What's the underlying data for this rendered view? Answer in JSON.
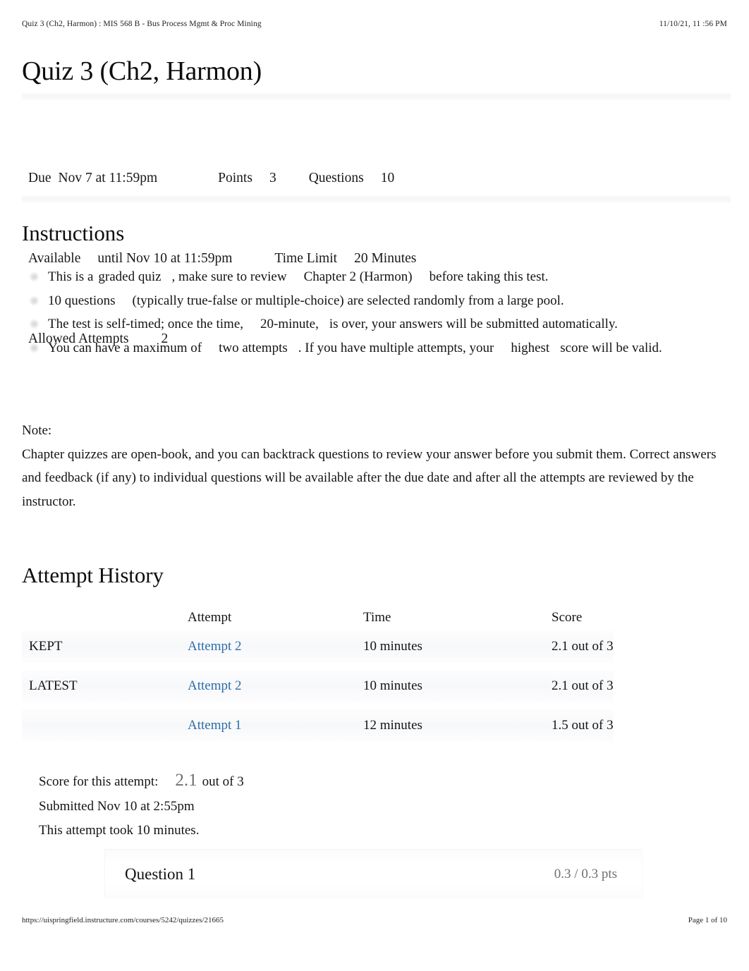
{
  "print_header": {
    "document_title": "Quiz 3 (Ch2, Harmon) : MIS 568 B - Bus Process Mgmt & Proc Mining",
    "timestamp": "11/10/21, 11 :56 PM"
  },
  "print_footer": {
    "url": "https://uispringfield.instructure.com/courses/5242/quizzes/21665",
    "page_label": "Page 1 of 10"
  },
  "quiz": {
    "title": "Quiz 3 (Ch2, Harmon)",
    "meta": {
      "due_label": "Due",
      "due_value": "Nov 7 at 11:59pm",
      "points_label": "Points",
      "points_value": "3",
      "questions_label": "Questions",
      "questions_value": "10",
      "available_label": "Available",
      "available_value": "until Nov 10 at 11:59pm",
      "time_limit_label": "Time Limit",
      "time_limit_value": "20 Minutes",
      "allowed_attempts_label": "Allowed Attempts",
      "allowed_attempts_value": "2"
    }
  },
  "instructions": {
    "heading": "Instructions",
    "items": [
      {
        "part1": "This is a",
        "emph1": "graded quiz",
        "part2": ", make sure to review",
        "emph2": "Chapter 2 (Harmon)",
        "part3": "before taking this test."
      },
      {
        "part1": "10 questions",
        "part2": "(typically true-false or multiple-choice) are selected randomly from a large pool."
      },
      {
        "part1": "The test is self-timed; once the time,",
        "emph1": "20-minute,",
        "part2": "is over, your answers will be submitted automatically."
      },
      {
        "part1": "You can have a maximum of",
        "emph1": "two attempts",
        "part2": ". If you have multiple attempts, your",
        "emph2": "highest",
        "part3": "score will be valid."
      }
    ],
    "note_label": "Note:",
    "note_body": "Chapter quizzes are open-book, and you can backtrack questions to review your answer before you submit them. Correct answers and feedback (if any) to individual questions will be available after the due date and after all the attempts are reviewed by the instructor."
  },
  "attempt_history": {
    "heading": "Attempt History",
    "columns": {
      "label": "",
      "attempt": "Attempt",
      "time": "Time",
      "score": "Score"
    },
    "rows": [
      {
        "label": "KEPT",
        "attempt": "Attempt 2",
        "time": "10 minutes",
        "score": "2.1 out of 3"
      },
      {
        "label": "LATEST",
        "attempt": "Attempt 2",
        "time": "10 minutes",
        "score": "2.1 out of 3"
      },
      {
        "label": "",
        "attempt": "Attempt 1",
        "time": "12 minutes",
        "score": "1.5 out of 3"
      }
    ]
  },
  "score_summary": {
    "score_label": "Score for this attempt:",
    "score_value": "2.1",
    "score_out_of": "out of 3",
    "submitted": "Submitted Nov 10 at 2:55pm",
    "duration": "This attempt took 10 minutes."
  },
  "question": {
    "title": "Question 1",
    "points": "0.3 / 0.3 pts"
  },
  "colors": {
    "link": "#2e6da8",
    "muted": "#6e6e6e",
    "text": "#141414",
    "band": "#f6f6f8"
  }
}
